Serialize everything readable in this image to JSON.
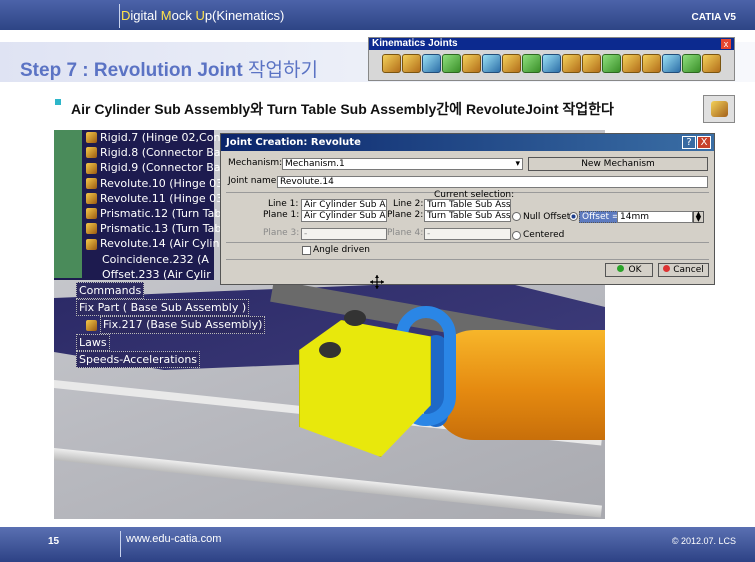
{
  "header": {
    "title_parts": [
      "D",
      "igital ",
      "M",
      "ock ",
      "U",
      "p(Kinematics)"
    ],
    "brand": "CATIA V5"
  },
  "step": {
    "title_latin": "Step 7 : Revolution Joint ",
    "title_korean": "작업하기"
  },
  "kinematics_toolbar": {
    "title": "Kinematics Joints",
    "close": "x",
    "icons": [
      "revolute-joint",
      "prismatic-joint",
      "cylindrical-joint",
      "screw-joint",
      "sphere-joint",
      "planar-joint",
      "rigid-joint",
      "point-curve-joint",
      "slide-curve-joint",
      "roll-curve-joint",
      "point-surface-joint",
      "universal-joint",
      "cv-joint",
      "gear-joint",
      "rack-joint",
      "cable-joint",
      "axis-system-joint"
    ]
  },
  "description": "Air Cylinder Sub Assembly와 Turn Table Sub Assembly간에 RevoluteJoint 작업한다",
  "spec_tree": {
    "rows": [
      "Rigid.7 (Hinge 02,Con",
      "Rigid.8 (Connector Ba",
      "Rigid.9 (Connector Ba",
      "Revolute.10 (Hinge 03",
      "Revolute.11 (Hinge 03",
      "Prismatic.12 (Turn Tab",
      "Prismatic.13 (Turn Tab",
      "Revolute.14 (Air Cylin",
      "Coincidence.232 (A",
      "Offset.233 (Air Cylir",
      "Commands",
      "Fix Part ( Base Sub Assembly )",
      "Fix.217 (Base Sub Assembly)",
      "Laws",
      "Speeds-Accelerations"
    ]
  },
  "dialog": {
    "title": "Joint Creation: Revolute",
    "help": "?",
    "close": "X",
    "mechanism_label": "Mechanism:",
    "mechanism_value": "Mechanism.1",
    "new_mechanism": "New Mechanism",
    "joint_name_label": "Joint name:",
    "joint_name_value": "Revolute.14",
    "current_selection": "Current selection:",
    "line1_label": "Line 1:",
    "line1_value": "Air Cylinder Sub Ass",
    "line2_label": "Line 2:",
    "line2_value": "Turn Table Sub Asse",
    "plane1_label": "Plane 1:",
    "plane1_value": "Air Cylinder Sub Ass",
    "plane2_label": "Plane 2:",
    "plane2_value": "Turn Table Sub Asse",
    "plane3_label": "Plane 3:",
    "plane3_value": "-",
    "plane4_label": "Plane 4:",
    "plane4_value": "-",
    "null_offset": "Null Offset",
    "offset_label": "Offset =",
    "offset_value": "14mm",
    "centered": "Centered",
    "angle_driven": "Angle driven",
    "ok": "OK",
    "cancel": "Cancel"
  },
  "footer": {
    "page": "15",
    "url": "www.edu-catia.com",
    "copyright": "© 2012.07. LCS"
  },
  "colors": {
    "header_blue": "#2e4585",
    "step_blue": "#5b73c4",
    "highlight_yellow": "#ffe24a",
    "part_yellow": "#e8e80c",
    "cylinder_orange": "#e58a10",
    "ring_blue": "#2a86e6"
  }
}
